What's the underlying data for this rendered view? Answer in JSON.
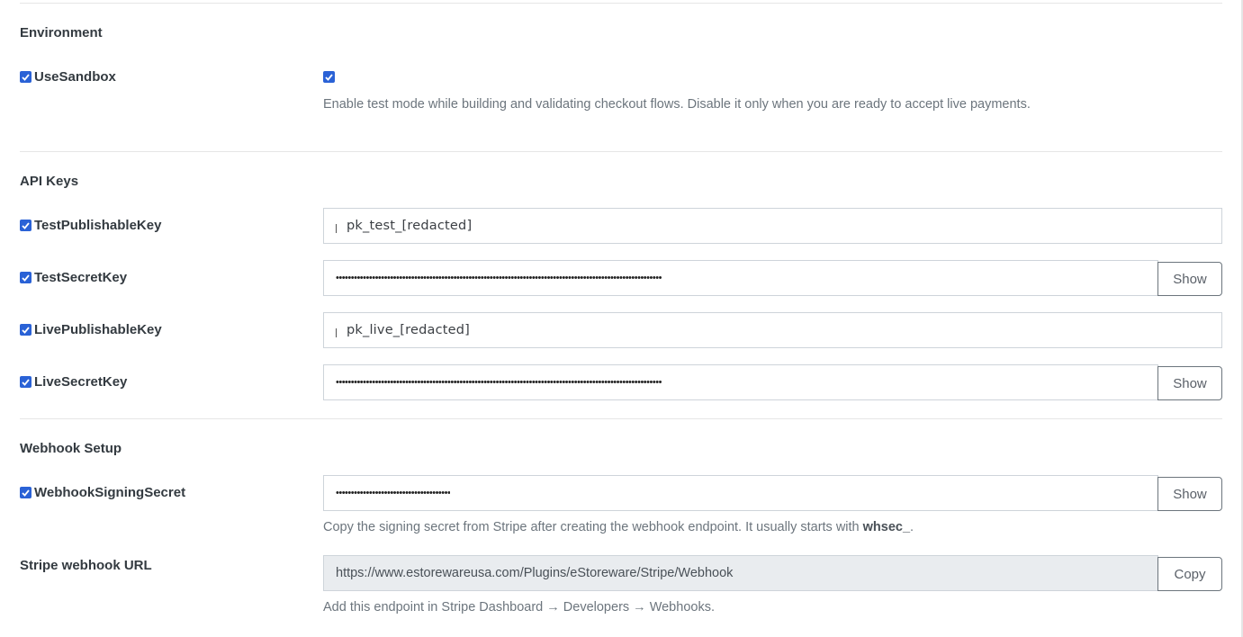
{
  "sections": {
    "environment": "Environment",
    "api_keys": "API Keys",
    "webhook_setup": "Webhook Setup"
  },
  "fields": {
    "use_sandbox": {
      "label": "UseSandbox",
      "checked": true,
      "help": "Enable test mode while building and validating checkout flows. Disable it only when you are ready to accept live payments."
    },
    "test_publishable_key": {
      "label": "TestPublishableKey",
      "value": "pk_test_[redacted]"
    },
    "test_secret_key": {
      "label": "TestSecretKey",
      "value": "••••••••••••••••••••••••••••••••••••••••••••••••••••••••••••••••••••••••••••••••••••••••••••••••••••••••••••",
      "button": "Show"
    },
    "live_publishable_key": {
      "label": "LivePublishableKey",
      "value": "pk_live_[redacted]"
    },
    "live_secret_key": {
      "label": "LiveSecretKey",
      "value": "••••••••••••••••••••••••••••••••••••••••••••••••••••••••••••••••••••••••••••••••••••••••••••••••••••••••••••",
      "button": "Show"
    },
    "webhook_signing_secret": {
      "label": "WebhookSigningSecret",
      "value": "••••••••••••••••••••••••••••••••••••••",
      "button": "Show",
      "help_prefix": "Copy the signing secret from Stripe after creating the webhook endpoint. It usually starts with ",
      "help_code": "whsec_",
      "help_suffix": "."
    },
    "stripe_webhook_url": {
      "label": "Stripe webhook URL",
      "value": "https://www.estorewareusa.com/Plugins/eStoreware/Stripe/Webhook",
      "button": "Copy",
      "help": "Add this endpoint in Stripe Dashboard → Developers → Webhooks."
    }
  },
  "colors": {
    "accent": "#2a62d6",
    "muted_text": "#6c757d",
    "readonly_bg": "#e9ecef"
  }
}
